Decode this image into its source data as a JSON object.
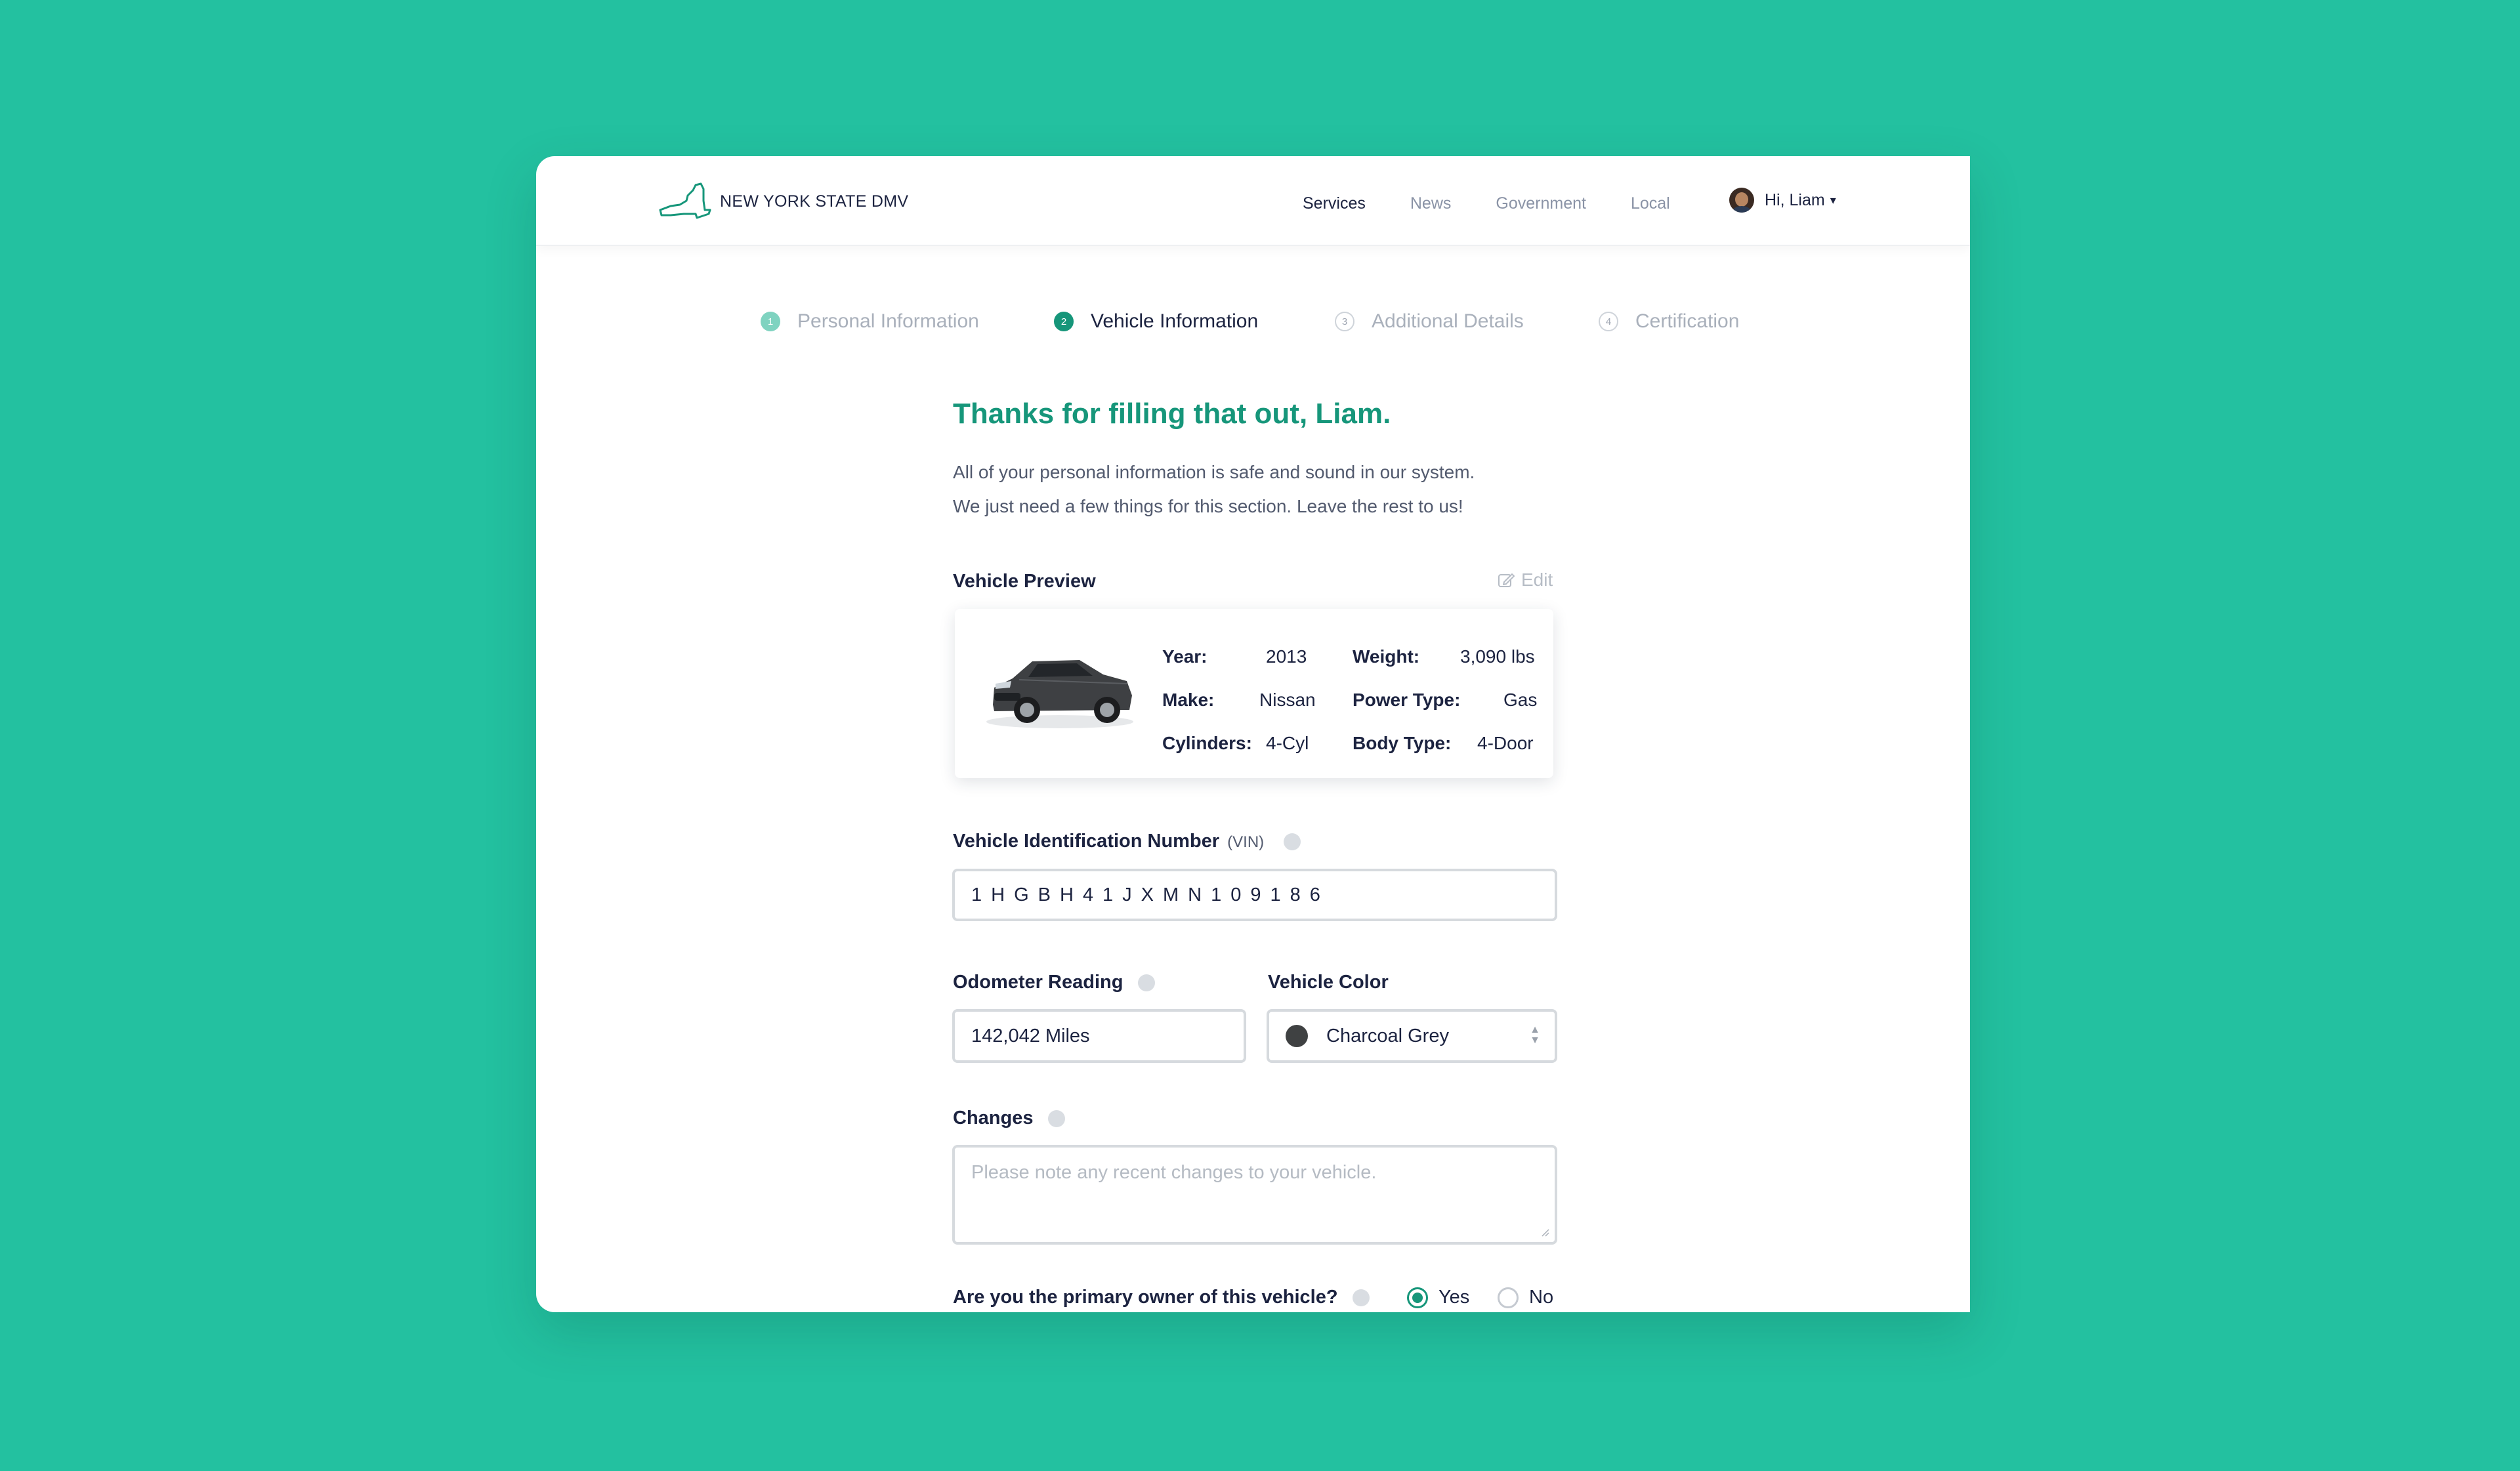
{
  "header": {
    "brand": "NEW YORK STATE DMV",
    "logo_icon": "new-york-state-outline-icon",
    "nav": [
      "Services",
      "News",
      "Government",
      "Local"
    ],
    "active_nav": "Services",
    "user_greeting": "Hi, Liam",
    "user_caret": "▾"
  },
  "steps": [
    {
      "num": "1",
      "label": "Personal Information",
      "state": "done"
    },
    {
      "num": "2",
      "label": "Vehicle Information",
      "state": "current"
    },
    {
      "num": "3",
      "label": "Additional Details",
      "state": "upcoming"
    },
    {
      "num": "4",
      "label": "Certification",
      "state": "upcoming"
    }
  ],
  "main": {
    "heading": "Thanks for filling that out, Liam.",
    "intro_line1": "All of your personal information is safe and sound in our system.",
    "intro_line2": "We just need a few things for this section. Leave the rest to us!"
  },
  "preview": {
    "label": "Vehicle Preview",
    "edit_label": "Edit",
    "specs": {
      "year_label": "Year:",
      "year": "2013",
      "make_label": "Make:",
      "make": "Nissan",
      "cylinders_label": "Cylinders:",
      "cylinders": "4-Cyl",
      "weight_label": "Weight:",
      "weight": "3,090 lbs",
      "power_label": "Power Type:",
      "power": "Gas",
      "body_label": "Body Type:",
      "body": "4-Door"
    }
  },
  "form": {
    "vin_label": "Vehicle Identification Number",
    "vin_suffix": "(VIN)",
    "vin_value": "1HGBH41JXMN109186",
    "odometer_label": "Odometer Reading",
    "odometer_value": "142,042 Miles",
    "color_label": "Vehicle Color",
    "color_value": "Charcoal Grey",
    "color_swatch": "#3f4142",
    "changes_label": "Changes",
    "changes_placeholder": "Please note any recent changes to your vehicle.",
    "owner_question": "Are you the primary owner of this vehicle?",
    "owner_yes": "Yes",
    "owner_no": "No",
    "owner_selected": "Yes"
  },
  "colors": {
    "background": "#23c1a0",
    "accent": "#16967a",
    "text_dark": "#1c2340"
  }
}
